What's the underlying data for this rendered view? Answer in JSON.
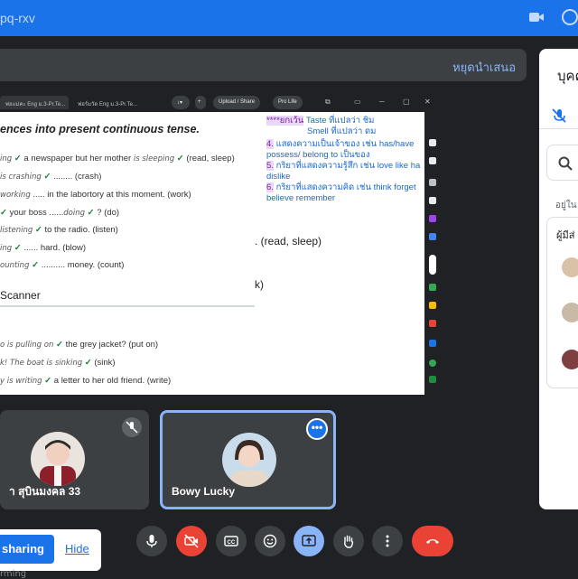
{
  "meeting": {
    "code_fragment": "pq-rxv",
    "accent": "#1a73e8"
  },
  "presentation": {
    "stop_label": "หยุดนำเสนอ"
  },
  "browser": {
    "tabs": [
      "พ่อแม่คะ Eng ม.3-Pr.Te...",
      "ฟอร์มวัด Eng ม.3-Pr.Te..."
    ],
    "upload_label": "Upload / Share",
    "profile_label": "Pro Life"
  },
  "worksheet": {
    "title": "ences into present continuous tense.",
    "lines": [
      {
        "answer": "ing",
        "text": "a newspaper but her mother",
        "answer2": "is sleeping",
        "hint": "(read, sleep)"
      },
      {
        "answer": "is crashing",
        "text": "",
        "answer2": "",
        "hint": "(crash)"
      },
      {
        "answer": "working",
        "text": "in the labortory at this moment.",
        "answer2": "",
        "hint": "(work)"
      },
      {
        "answer": "",
        "text": "your boss",
        "answer2": "doing",
        "hint": "? (do)"
      },
      {
        "answer": "listening",
        "text": "to the radio.",
        "answer2": "",
        "hint": "(listen)"
      },
      {
        "answer": "ing",
        "text": "hard.",
        "answer2": "",
        "hint": "(blow)"
      },
      {
        "answer": "ounting",
        "text": "money.",
        "answer2": "",
        "hint": "(count)"
      }
    ],
    "scanner_label": "Scanner",
    "big_hint": ". (read, sleep)",
    "big_hint2": "k)",
    "lower_lines": [
      {
        "answer": "o is pulling on",
        "text": "the grey jacket?",
        "hint": "(put on)"
      },
      {
        "answer": "k! The boat is sinking",
        "text": "",
        "hint": "(sink)"
      },
      {
        "answer": "y is writing",
        "text": "a letter to her old friend.",
        "hint": "(write)"
      }
    ],
    "notes": [
      {
        "prefix": "****ยกเว้น",
        "text": "Taste ที่แปลว่า ชิม"
      },
      {
        "prefix": "",
        "text": "Smell ที่แปลว่า ดม"
      },
      {
        "prefix": "4.",
        "text": "แสดงความเป็นเจ้าของ เช่น has/have"
      },
      {
        "prefix": "",
        "text": "possess/ belong to เป็นของ"
      },
      {
        "prefix": "5.",
        "text": "กริยาที่แสดงความรู้สึก เช่น love like ha"
      },
      {
        "prefix": "",
        "text": "dislike"
      },
      {
        "prefix": "6.",
        "text": "กริยาที่แสดงความคิด เช่น think forget"
      },
      {
        "prefix": "",
        "text": "believe remember"
      }
    ]
  },
  "participants": [
    {
      "name": "า สุบินมงคล 33",
      "muted": true
    },
    {
      "name": "Bowy Lucky",
      "speaking": true
    }
  ],
  "sidebar": {
    "heading": "บุคค",
    "list_label": "อยู่ใน",
    "list_header": "ผู้มีส่"
  },
  "share_card": {
    "button_label": "sharing",
    "hide_label": "Hide"
  },
  "bottom_handwriting": "rming"
}
